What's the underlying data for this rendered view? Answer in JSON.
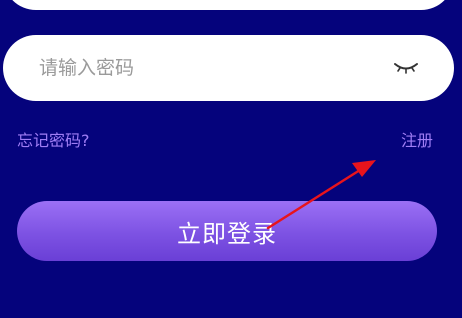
{
  "password_field": {
    "placeholder": "请输入密码",
    "toggle_icon": "eye-closed-icon"
  },
  "links": {
    "forgot_password": "忘记密码?",
    "register": "注册"
  },
  "login_button": {
    "label": "立即登录"
  },
  "annotation": {
    "arrow_color": "#e8141c",
    "points_to": "register"
  },
  "colors": {
    "background": "#05037c",
    "link": "#a07ef5",
    "button_gradient_top": "#9b70f5",
    "button_gradient_bottom": "#6a3fd6"
  }
}
